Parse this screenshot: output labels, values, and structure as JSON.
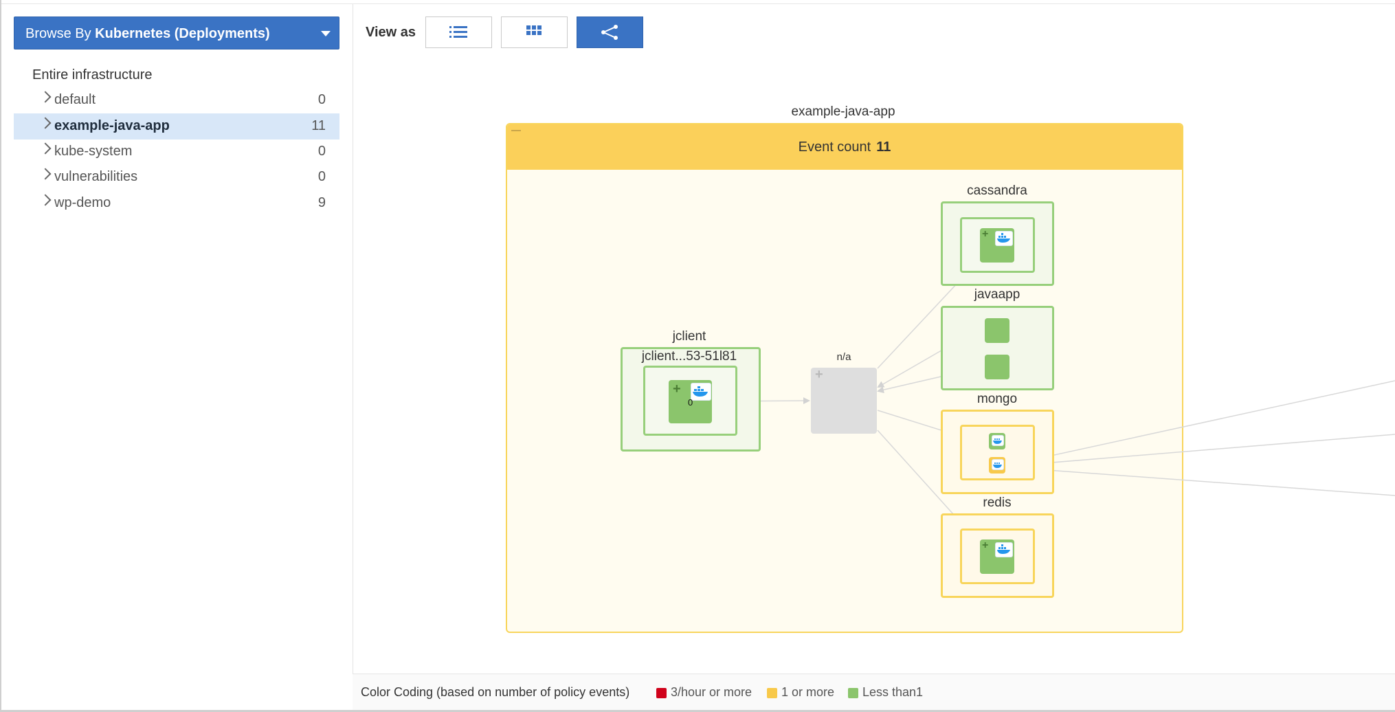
{
  "sidebar": {
    "browse_prefix": "Browse By",
    "browse_bold": "Kubernetes (Deployments)",
    "root_label": "Entire infrastructure",
    "items": [
      {
        "label": "default",
        "count": "0"
      },
      {
        "label": "example-java-app",
        "count": "11"
      },
      {
        "label": "kube-system",
        "count": "0"
      },
      {
        "label": "vulnerabilities",
        "count": "0"
      },
      {
        "label": "wp-demo",
        "count": "9"
      }
    ]
  },
  "toolbar": {
    "view_as_label": "View as",
    "view_modes": [
      {
        "icon": "list-icon",
        "active": false
      },
      {
        "icon": "grid-icon",
        "active": false
      },
      {
        "icon": "topology-icon",
        "active": true
      }
    ]
  },
  "graph": {
    "group_name": "example-java-app",
    "event_count_label": "Event count",
    "event_count_value": "11",
    "nodes": {
      "jclient": {
        "name": "jclient",
        "pod_label": "jclient...53-51l81",
        "count": "0"
      },
      "na": {
        "name": "n/a"
      },
      "cassandra": {
        "name": "cassandra"
      },
      "javaapp": {
        "name": "javaapp"
      },
      "mongo": {
        "name": "mongo"
      },
      "redis": {
        "name": "redis"
      }
    }
  },
  "legend": {
    "title": "Color Coding (based on number of policy events)",
    "items": [
      {
        "label": "3/hour or more",
        "color": "#d0021b"
      },
      {
        "label": "1 or more",
        "color": "#f8c94a"
      },
      {
        "label": "Less than1",
        "color": "#8bc56c"
      }
    ]
  }
}
